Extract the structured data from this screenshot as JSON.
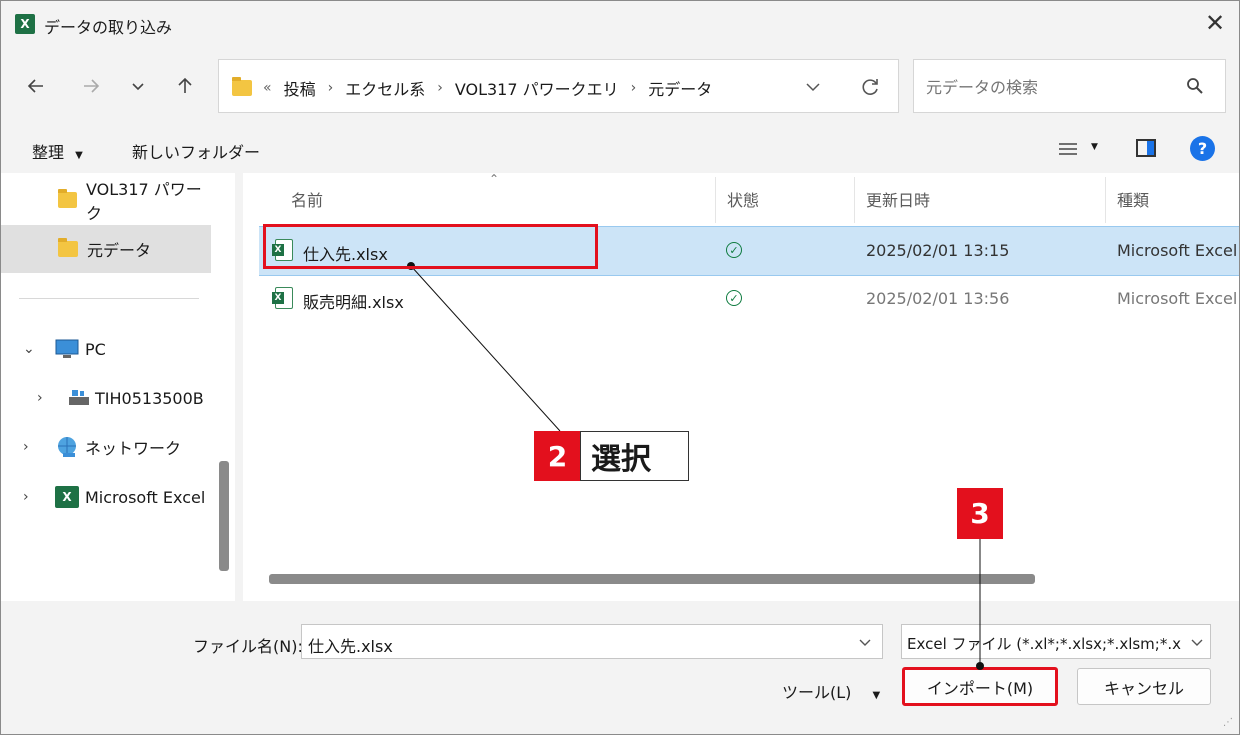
{
  "window": {
    "title": "データの取り込み",
    "close_glyph": "✕"
  },
  "address_bar": {
    "overflow_glyph": "«",
    "crumbs": [
      "投稿",
      "エクセル系",
      "VOL317 パワークエリ",
      "元データ"
    ],
    "separator": "›"
  },
  "search": {
    "placeholder": "元データの検索"
  },
  "commands": {
    "organize": "整理",
    "new_folder": "新しいフォルダー"
  },
  "sidebar": {
    "items": [
      {
        "label": "VOL317 パワーク",
        "icon": "folder-icon"
      },
      {
        "label": "元データ",
        "icon": "folder-icon",
        "selected": true
      },
      {
        "label": "PC",
        "icon": "pc-icon",
        "expander": "⌄"
      },
      {
        "label": "TIH0513500B",
        "icon": "network-drive-icon",
        "expander": "›"
      },
      {
        "label": "ネットワーク",
        "icon": "network-icon",
        "expander": "›"
      },
      {
        "label": "Microsoft Excel",
        "icon": "excel-icon",
        "expander": "›"
      }
    ]
  },
  "file_list": {
    "columns": [
      "名前",
      "状態",
      "更新日時",
      "種類"
    ],
    "rows": [
      {
        "name": "仕入先.xlsx",
        "status": "synced",
        "modified": "2025/02/01 13:15",
        "type": "Microsoft Excel",
        "selected": true
      },
      {
        "name": "販売明細.xlsx",
        "status": "synced",
        "modified": "2025/02/01 13:56",
        "type": "Microsoft Excel",
        "selected": false
      }
    ]
  },
  "bottom": {
    "filename_label": "ファイル名(N):",
    "filename_value": "仕入先.xlsx",
    "filter_value": "Excel ファイル (*.xl*;*.xlsx;*.xlsm;*.xls",
    "tools_label": "ツール(L)",
    "import_label": "インポート(M)",
    "cancel_label": "キャンセル"
  },
  "annotations": {
    "callout2": {
      "number": "2",
      "label": "選択"
    },
    "callout3": {
      "number": "3"
    }
  },
  "colors": {
    "accent_red": "#e3101d",
    "selection": "#cce4f7",
    "excel_green": "#1e7145",
    "help_blue": "#1a73e8"
  }
}
